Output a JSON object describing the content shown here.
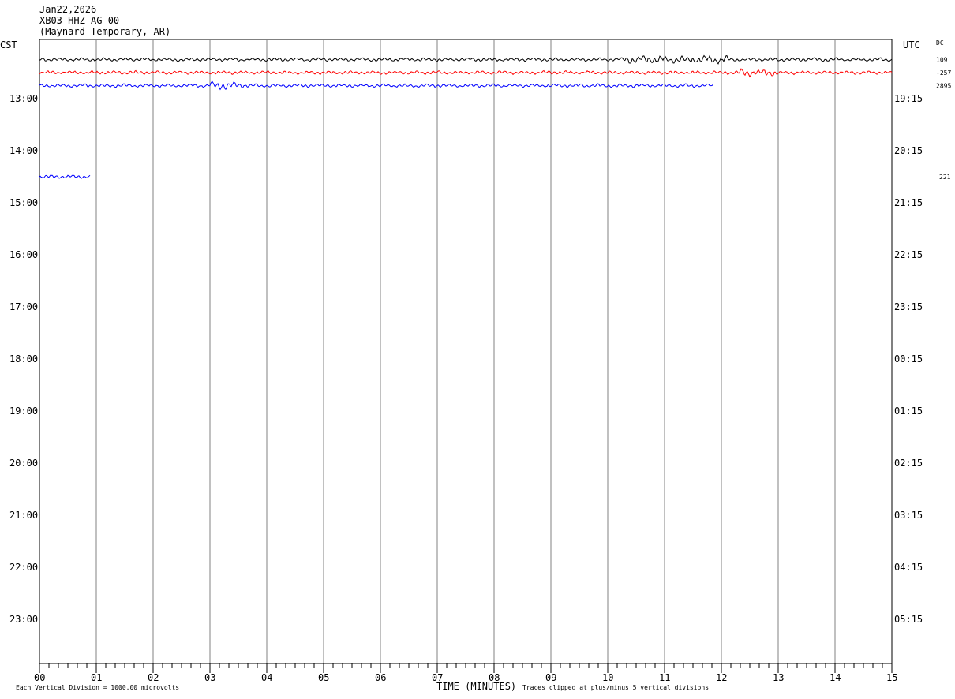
{
  "header": {
    "date": "Jan22,2026",
    "station": "XB03 HHZ AG 00",
    "location": "(Maynard Temporary, AR)"
  },
  "axes": {
    "left_title": "CST",
    "right_title": "UTC",
    "dc_label": "DC",
    "x_title": "TIME (MINUTES)",
    "x_ticks": [
      "00",
      "01",
      "02",
      "03",
      "04",
      "05",
      "06",
      "07",
      "08",
      "09",
      "10",
      "11",
      "12",
      "13",
      "14",
      "15"
    ],
    "left_hours": [
      "13:00",
      "14:00",
      "15:00",
      "16:00",
      "17:00",
      "18:00",
      "19:00",
      "20:00",
      "21:00",
      "22:00",
      "23:00"
    ],
    "right_hours": [
      "19:15",
      "20:15",
      "21:15",
      "22:15",
      "23:15",
      "00:15",
      "01:15",
      "02:15",
      "03:15",
      "04:15",
      "05:15"
    ]
  },
  "footer": {
    "scale_note": "Each Vertical Division = 1000.00 microvolts",
    "clip_note": "Traces clipped at plus/minus 5 vertical divisions"
  },
  "chart_data": {
    "type": "line",
    "title": "",
    "xlabel": "TIME (MINUTES)",
    "xlim": [
      0,
      15
    ],
    "series": [
      {
        "row": "12:15",
        "color": "#000000",
        "start_min": 0,
        "end_min": 15,
        "dc_offset": "109",
        "amplitude": 2.5,
        "burst": [
          10.3,
          12.1
        ]
      },
      {
        "row": "12:30",
        "color": "#ff0000",
        "start_min": 0,
        "end_min": 15,
        "dc_offset": "-257",
        "amplitude": 2.5,
        "burst": [
          12.3,
          13.0
        ]
      },
      {
        "row": "12:45",
        "color": "#0000ff",
        "start_min": 0,
        "end_min": 11.85,
        "dc_offset": "2895",
        "amplitude": 2.5,
        "burst": [
          3.0,
          3.6
        ]
      },
      {
        "row": "14:30",
        "color": "#0000ff",
        "start_min": 0,
        "end_min": 0.9,
        "dc_offset": "221",
        "amplitude": 2.5,
        "burst": null
      }
    ]
  }
}
